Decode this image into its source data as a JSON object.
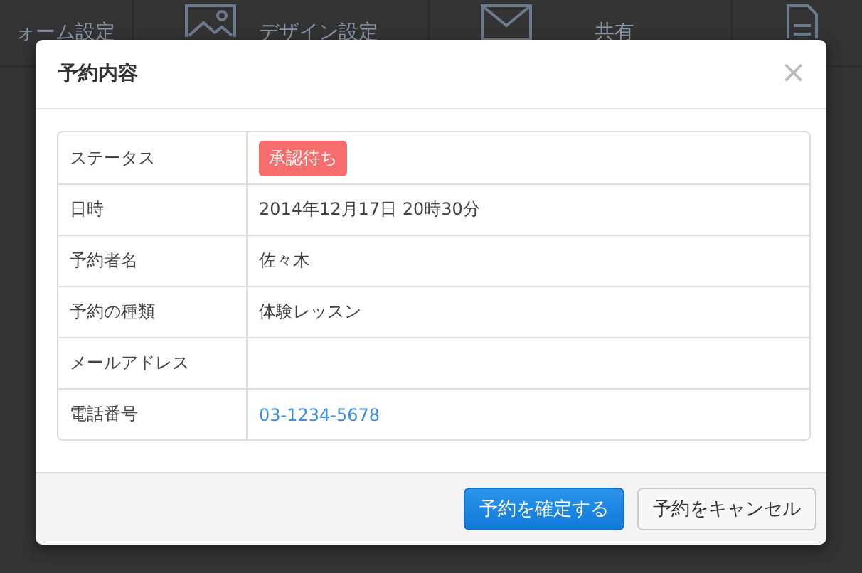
{
  "background": {
    "nav_items": [
      {
        "label": "ォーム設定",
        "kind": "plain"
      },
      {
        "label": "デザイン設定",
        "kind": "picture"
      },
      {
        "label": "共有",
        "kind": "envelope"
      },
      {
        "kind": "page"
      }
    ]
  },
  "modal": {
    "title": "予約内容",
    "close": "×",
    "rows": [
      {
        "label": "ステータス",
        "kind": "badge",
        "value": "承認待ち",
        "color": "#f76c6c"
      },
      {
        "label": "日時",
        "kind": "text",
        "value": "2014年12月17日 20時30分"
      },
      {
        "label": "予約者名",
        "kind": "text",
        "value": "佐々木"
      },
      {
        "label": "予約の種類",
        "kind": "text",
        "value": "体験レッスン"
      },
      {
        "label": "メールアドレス",
        "kind": "empty"
      },
      {
        "label": "電話番号",
        "kind": "link",
        "value": "03-1234-5678"
      }
    ],
    "buttons": [
      {
        "label": "予約を確定する",
        "kind": "primary"
      },
      {
        "label": "予約をキャンセル",
        "kind": "default"
      }
    ]
  }
}
